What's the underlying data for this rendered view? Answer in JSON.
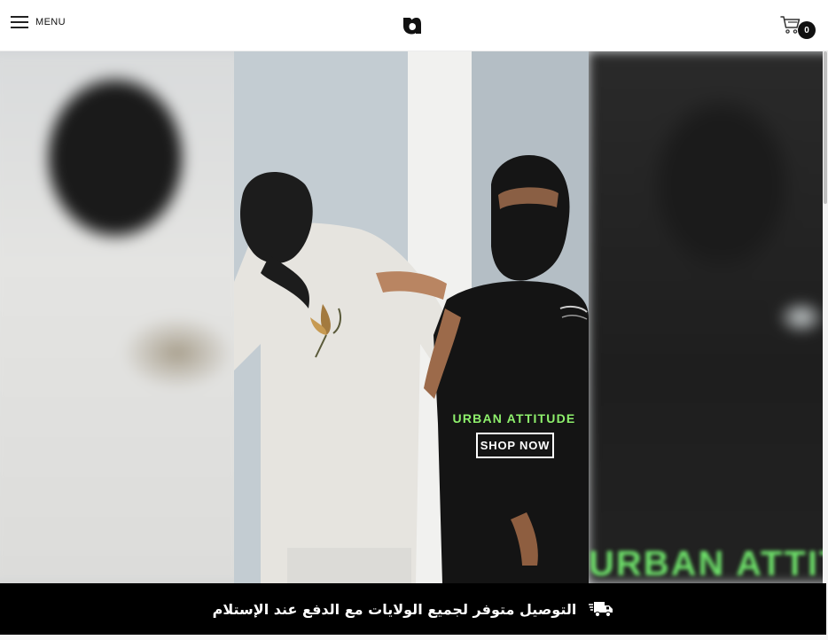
{
  "header": {
    "menu_label": "MENU",
    "cart_count": "0",
    "icons": {
      "menu": "hamburger-icon",
      "logo": "brand-logo",
      "cart": "shopping-cart-icon"
    }
  },
  "hero": {
    "promo_title": "URBAN ATTITUDE",
    "cta_label": "SHOP NOW",
    "background_text": "URBAN ATTITUDE",
    "accent_color": "#8ef06c"
  },
  "shipping_bar": {
    "text": "التوصيل متوفر لجميع الولايات مع الدفع عند الإستلام",
    "icon": "delivery-truck-icon",
    "background": "#000000"
  }
}
